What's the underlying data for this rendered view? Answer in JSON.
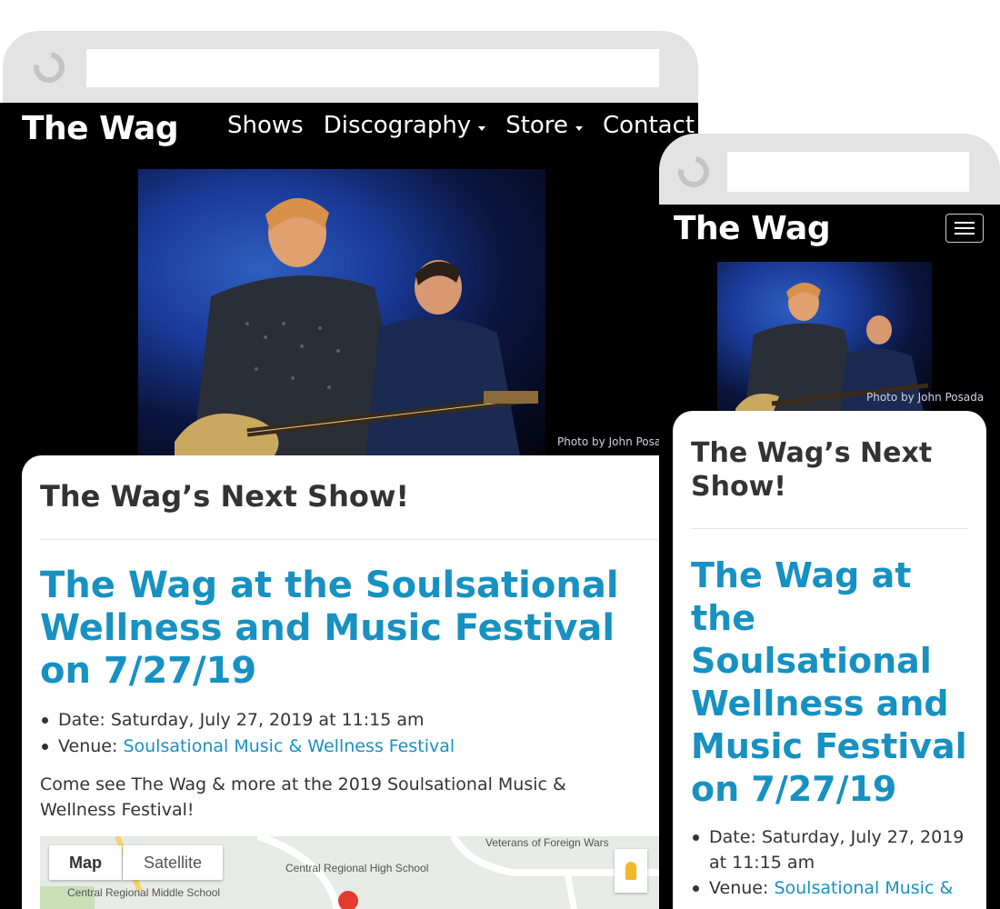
{
  "site": {
    "brand": "The Wag",
    "nav": [
      {
        "label": "Shows",
        "dropdown": false
      },
      {
        "label": "Discography",
        "dropdown": true
      },
      {
        "label": "Store",
        "dropdown": true
      },
      {
        "label": "Contact",
        "dropdown": false
      }
    ]
  },
  "hero": {
    "photo_credit": "Photo by John Posada",
    "photo_credit_desktop_visible": "Photo by John Posad"
  },
  "main": {
    "heading": "The Wag’s Next Show!",
    "event": {
      "title": "The Wag at the Soulsational Wellness and Music Festival on 7/27/19",
      "date_label": "Date:",
      "date_value": "Saturday, July 27, 2019 at 11:15 am",
      "venue_label": "Venue:",
      "venue_link": "Soulsational Music & Wellness Festival",
      "venue_link_mobile_visible": "Soulsational Music &",
      "description": "Come see The Wag & more at the 2019 Soulsational Music & Wellness Festival!"
    }
  },
  "map": {
    "type_buttons": [
      "Map",
      "Satellite"
    ],
    "selected": "Map",
    "labels": [
      "Veterans of Foreign Wars",
      "Central Regional High School",
      "Central Regional Middle School"
    ]
  },
  "colors": {
    "link": "#1791c2",
    "page_bg": "#000000",
    "browser_chrome": "#e3e3e3"
  },
  "icons": [
    "reload-icon",
    "dropdown-caret-icon",
    "hamburger-menu-icon",
    "map-pin-icon",
    "pegman-icon"
  ]
}
